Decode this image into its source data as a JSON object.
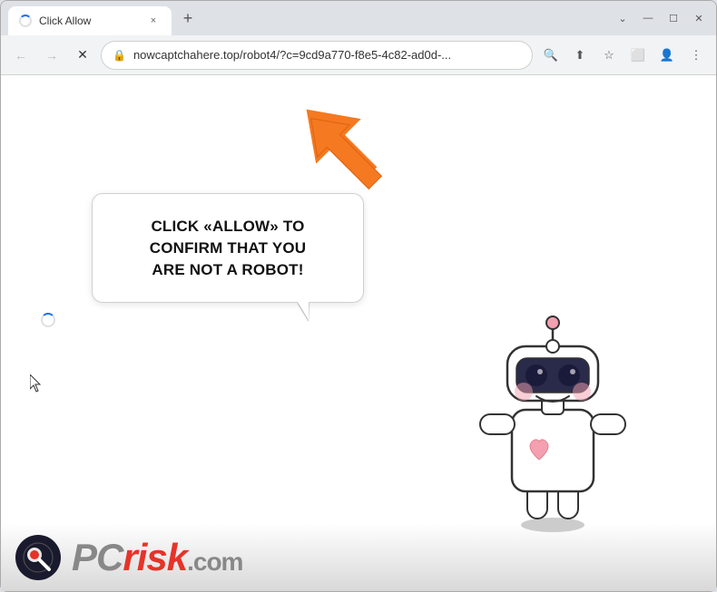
{
  "browser": {
    "title": "Click Allow",
    "tab": {
      "title": "Click Allow",
      "close_label": "×"
    },
    "new_tab_label": "+",
    "window_controls": {
      "chevron": "⌄",
      "minimize": "—",
      "maximize": "☐",
      "close": "✕"
    },
    "toolbar": {
      "back_label": "←",
      "forward_label": "→",
      "reload_label": "✕",
      "url": "nowcaptchahere.top/robot4/?c=9cd9a770-f8e5-4c82-ad0d-...",
      "search_icon": "🔍",
      "share_icon": "⬆",
      "star_icon": "☆",
      "split_icon": "⬜",
      "profile_icon": "👤",
      "menu_icon": "⋮"
    }
  },
  "page": {
    "bubble_text_line1": "CLICK «ALLOW» TO CONFIRM THAT YOU",
    "bubble_text_line2": "ARE NOT A ROBOT!",
    "bubble_text_combined": "CLICK «ALLOW» TO CONFIRM THAT YOU ARE NOT A ROBOT!"
  },
  "watermark": {
    "domain": ".com",
    "pc_text": "PC",
    "risk_text": "risk"
  }
}
